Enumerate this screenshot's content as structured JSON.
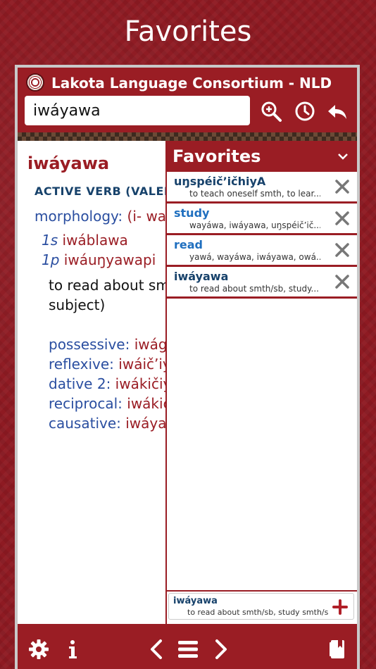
{
  "screen_title": "Favorites",
  "app": {
    "title": "Lakota Language Consortium - NLD",
    "search_value": "iwáyawa"
  },
  "entry": {
    "headword": "iwáyawa",
    "pos_main": "ACTIVE VERB",
    "pos_extra": " (VALENCY",
    "morph_label": "morphology:",
    "morph_value": " (i- wa",
    "conj": [
      {
        "person": "1s",
        "form": "iwáblawa"
      },
      {
        "person": "1p",
        "form": "iwáuŋyawapi"
      }
    ],
    "definition_line1": "to read about smt",
    "definition_line2": "subject)",
    "derived": [
      {
        "label": "possessive:",
        "value": " iwágl"
      },
      {
        "label": "reflexive:",
        "value": " iwáič’iy"
      },
      {
        "label": "dative 2:",
        "value": " iwákičiya"
      },
      {
        "label": "reciprocal:",
        "value": " iwákič"
      },
      {
        "label": "causative:",
        "value": " iwáyaw"
      }
    ]
  },
  "favorites": {
    "title": "Favorites",
    "items": [
      {
        "word": "uŋspéič’ičhiyA",
        "def": "to teach oneself smth, to lear...",
        "color": "#17426b"
      },
      {
        "word": "study",
        "def": "wayáwa, iwáyawa, uŋspéič’ič...",
        "color": "#1f6fbf"
      },
      {
        "word": "read",
        "def": "yawá, wayáwa, iwáyawa, owá...",
        "color": "#1f6fbf"
      },
      {
        "word": "iwáyawa",
        "def": "to read about smth/sb, study...",
        "color": "#17426b"
      }
    ],
    "add": {
      "word": "iwáyawa",
      "def": "to read about smth/sb, study smth/sb (a s..."
    }
  },
  "icons": {
    "zoom": "zoom-in-icon",
    "history": "history-clock-icon",
    "back": "reply-back-icon",
    "settings": "gear-icon",
    "info": "info-icon",
    "prev": "chevron-left-icon",
    "menu": "hamburger-menu-icon",
    "next": "chevron-right-icon",
    "bookmark": "book-bookmark-icon"
  }
}
